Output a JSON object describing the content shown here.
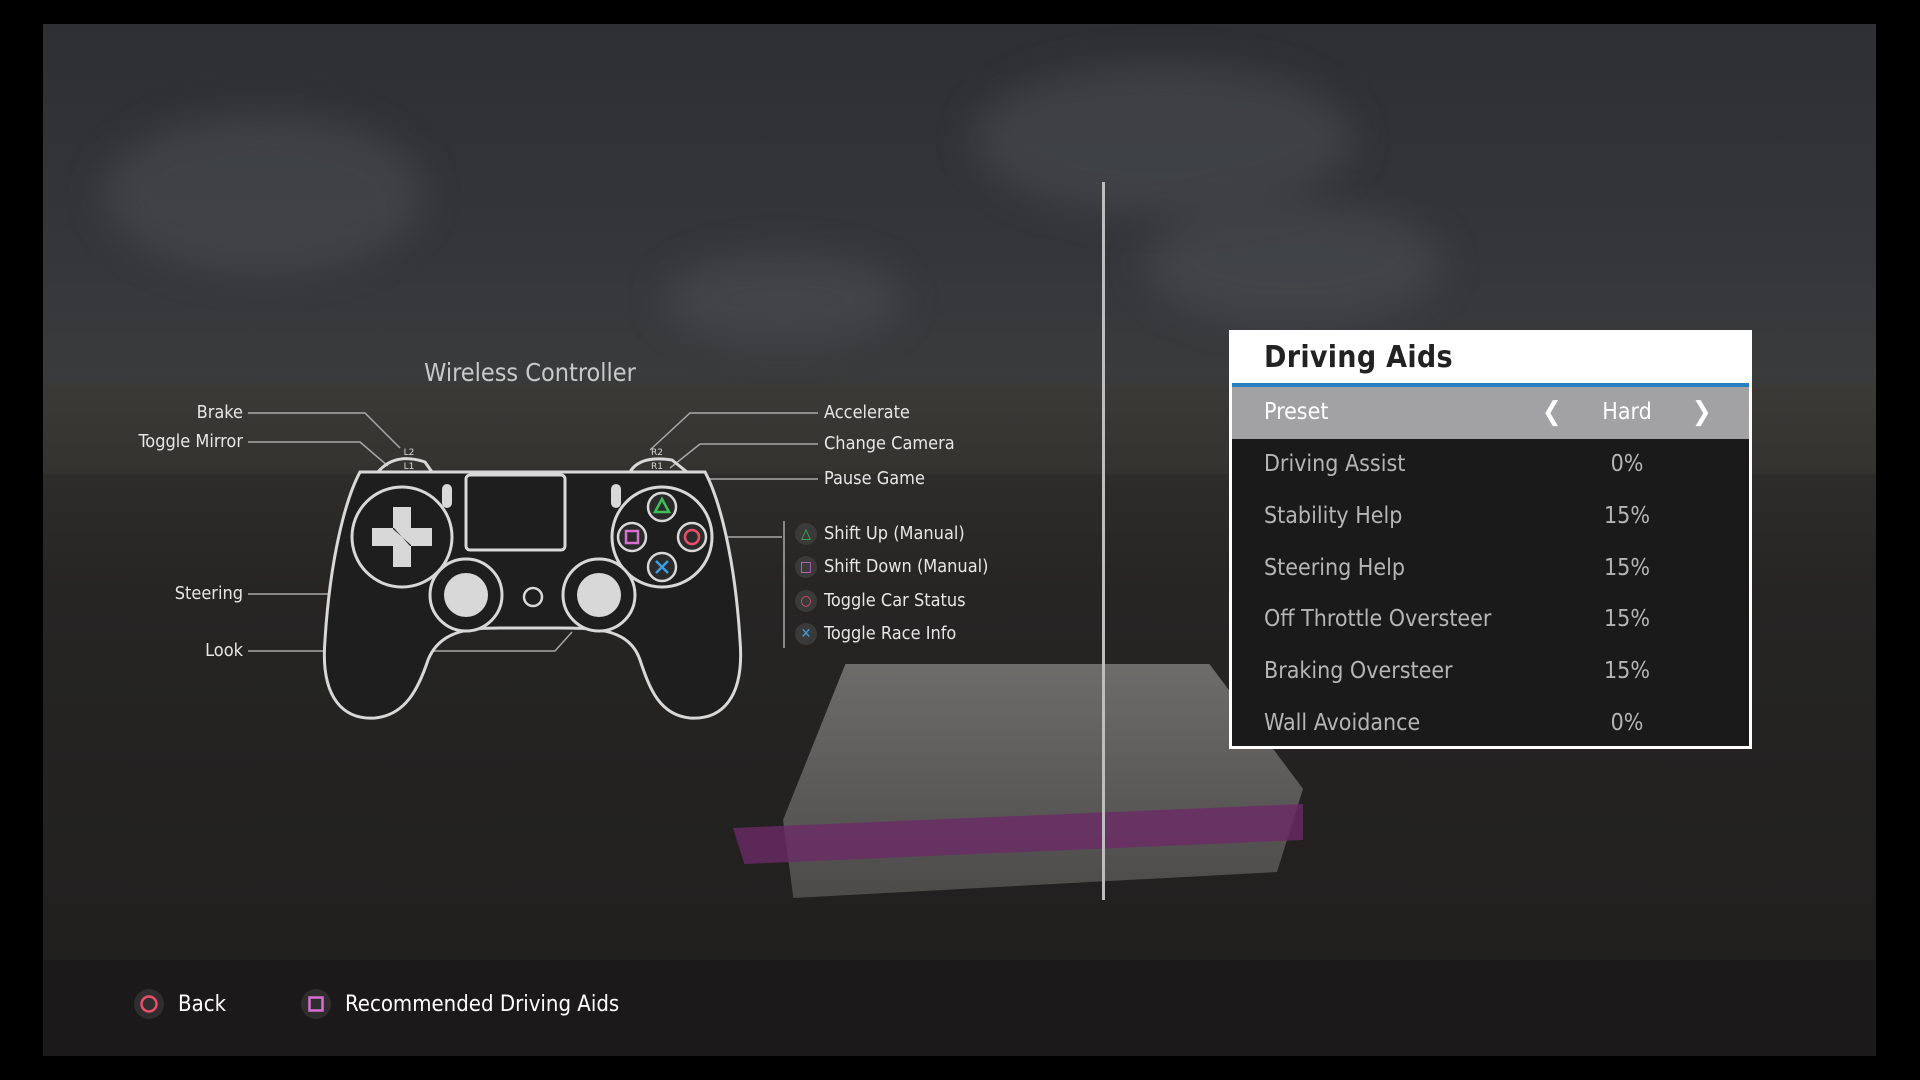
{
  "controller": {
    "title": "Wireless Controller",
    "left_labels": [
      {
        "label": "Brake",
        "button": "L2"
      },
      {
        "label": "Toggle Mirror",
        "button": "L1"
      },
      {
        "label": "Steering",
        "button": "left-stick"
      },
      {
        "label": "Look",
        "button": "right-stick"
      }
    ],
    "right_labels": [
      {
        "label": "Accelerate",
        "button": "R2"
      },
      {
        "label": "Change Camera",
        "button": "R1"
      },
      {
        "label": "Pause Game",
        "button": "options"
      }
    ],
    "face_buttons": [
      {
        "label": "Shift Up (Manual)",
        "icon": "triangle-icon",
        "color": "#3fbf5a"
      },
      {
        "label": "Shift Down (Manual)",
        "icon": "square-icon",
        "color": "#d96fd3"
      },
      {
        "label": "Toggle Car Status",
        "icon": "circle-icon",
        "color": "#e8506a"
      },
      {
        "label": "Toggle Race Info",
        "icon": "cross-icon",
        "color": "#3d9ee0"
      }
    ],
    "shoulder_marks": {
      "l2": "L2",
      "l1": "L1",
      "r2": "R2",
      "r1": "R1"
    }
  },
  "panel": {
    "title": "Driving Aids",
    "accent": "#2a7fc1",
    "preset": {
      "label": "Preset",
      "value": "Hard"
    },
    "rows": [
      {
        "label": "Driving Assist",
        "value": "0%"
      },
      {
        "label": "Stability Help",
        "value": "15%"
      },
      {
        "label": "Steering Help",
        "value": "15%"
      },
      {
        "label": "Off Throttle Oversteer",
        "value": "15%"
      },
      {
        "label": "Braking Oversteer",
        "value": "15%"
      },
      {
        "label": "Wall Avoidance",
        "value": "0%"
      }
    ]
  },
  "footer": {
    "back": {
      "label": "Back",
      "icon": "circle-icon"
    },
    "recommended": {
      "label": "Recommended Driving Aids",
      "icon": "square-icon"
    }
  }
}
